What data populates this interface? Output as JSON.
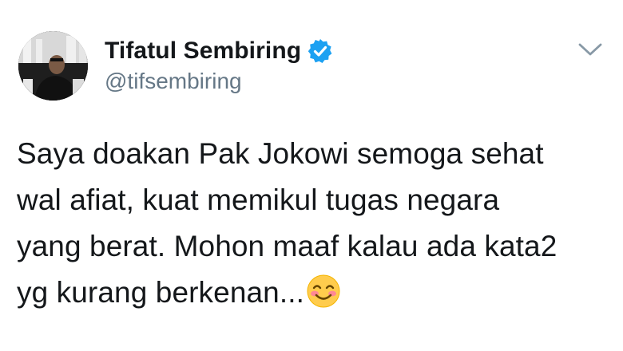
{
  "tweet": {
    "author": {
      "display_name": "Tifatul Sembiring",
      "handle": "@tifsembiring",
      "verified": true,
      "avatar_icon": "profile-photo"
    },
    "text_lines": [
      "Saya doakan Pak Jokowi semoga sehat",
      "wal afiat, kuat memikul tugas negara",
      "yang berat. Mohon maaf kalau ada kata2",
      "yg kurang berkenan..."
    ],
    "emoji": "smiling-face-with-blushing-cheeks",
    "menu_icon": "chevron-down-icon"
  },
  "colors": {
    "text": "#14171a",
    "secondary": "#657786",
    "verified_blue": "#1da1f2",
    "background": "#ffffff"
  }
}
